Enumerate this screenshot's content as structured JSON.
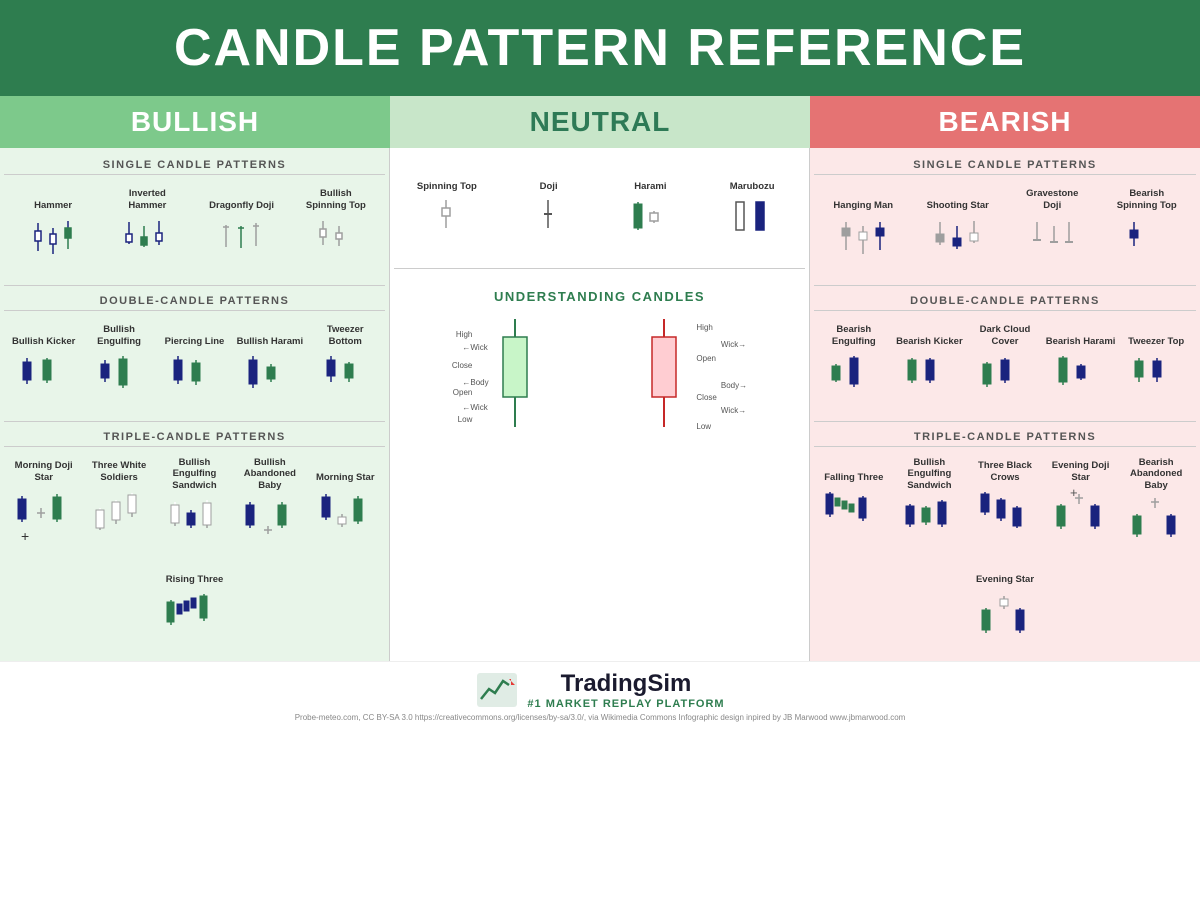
{
  "header": {
    "title": "CANDLE PATTERN REFERENCE"
  },
  "columns": {
    "bullish": {
      "label": "BULLISH"
    },
    "neutral": {
      "label": "NEUTRAL"
    },
    "bearish": {
      "label": "BEARISH"
    }
  },
  "bullish": {
    "single_header": "SINGLE CANDLE PATTERNS",
    "single_patterns": [
      {
        "name": "Hammer"
      },
      {
        "name": "Inverted Hammer"
      },
      {
        "name": "Dragonfly Doji"
      },
      {
        "name": "Bullish Spinning Top"
      }
    ],
    "double_header": "DOUBLE-CANDLE PATTERNS",
    "double_patterns": [
      {
        "name": "Bullish Kicker"
      },
      {
        "name": "Bullish Engulfing"
      },
      {
        "name": "Piercing Line"
      },
      {
        "name": "Bullish Harami"
      },
      {
        "name": "Tweezer Bottom"
      }
    ],
    "triple_header": "TRIPLE-CANDLE PATTERNS",
    "triple_patterns": [
      {
        "name": "Morning Doji Star"
      },
      {
        "name": "Three White Soldiers"
      },
      {
        "name": "Bullish Engulfing Sandwich"
      },
      {
        "name": "Bullish Abandoned Baby"
      },
      {
        "name": "Morning Star"
      },
      {
        "name": "Rising Three"
      }
    ]
  },
  "neutral": {
    "single_patterns": [
      {
        "name": "Spinning Top"
      },
      {
        "name": "Doji"
      },
      {
        "name": "Harami"
      },
      {
        "name": "Marubozu"
      }
    ],
    "understanding_header": "UNDERSTANDING CANDLES",
    "candle_labels": {
      "bullish": {
        "high": "High",
        "close": "Close",
        "open": "Open",
        "low": "Low",
        "wick_top": "Wick",
        "body": "Body",
        "wick_bottom": "Wick"
      },
      "bearish": {
        "high": "High",
        "open": "Open",
        "close": "Close",
        "low": "Low",
        "wick_top": "Wick",
        "body": "Body",
        "wick_bottom": "Wick"
      }
    }
  },
  "bearish": {
    "single_header": "SINGLE CANDLE PATTERNS",
    "single_patterns": [
      {
        "name": "Hanging Man"
      },
      {
        "name": "Shooting Star"
      },
      {
        "name": "Gravestone Doji"
      },
      {
        "name": "Bearish Spinning Top"
      }
    ],
    "double_header": "DOUBLE-CANDLE PATTERNS",
    "double_patterns": [
      {
        "name": "Bearish Engulfing"
      },
      {
        "name": "Bearish Kicker"
      },
      {
        "name": "Dark Cloud Cover"
      },
      {
        "name": "Bearish Harami"
      },
      {
        "name": "Tweezer Top"
      }
    ],
    "triple_header": "TRIPLE-CANDLE PATTERNS",
    "triple_patterns": [
      {
        "name": "Falling Three"
      },
      {
        "name": "Bullish Engulfing Sandwich"
      },
      {
        "name": "Three Black Crows"
      },
      {
        "name": "Evening Doji Star"
      },
      {
        "name": "Bearish Abandoned Baby"
      },
      {
        "name": "Evening Star"
      }
    ]
  },
  "footer": {
    "brand": "TradingSim",
    "tagline": "#1 MARKET REPLAY PLATFORM",
    "credits": "Probe-meteo.com, CC BY-SA 3.0 https://creativecommons.org/licenses/by-sa/3.0/, via Wikimedia Commons     Infographic design inpired by JB Marwood www.jbmarwood.com"
  }
}
